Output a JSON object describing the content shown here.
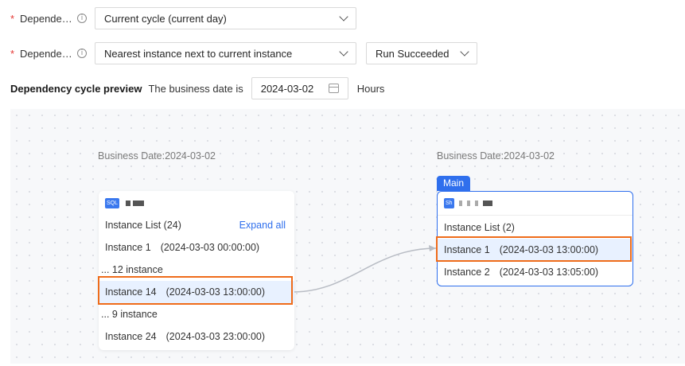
{
  "form": {
    "row1": {
      "label": "Depende…",
      "value": "Current cycle (current day)"
    },
    "row2": {
      "label": "Depende…",
      "value": "Nearest instance next to current instance",
      "status_value": "Run Succeeded"
    },
    "required_mark": "*",
    "info_icon": "info-circle-icon"
  },
  "preview": {
    "title": "Dependency cycle preview",
    "subtitle": "The business date is",
    "date": "2024-03-02",
    "unit": "Hours"
  },
  "upstream": {
    "business_date": "Business Date:2024-03-02",
    "tag": "SQL",
    "list_header": "Instance List (24)",
    "expand_label": "Expand all",
    "items": [
      {
        "name": "Instance 1",
        "time": "(2024-03-03 00:00:00)"
      },
      {
        "collapsed": "... 12 instance"
      },
      {
        "name": "Instance 14",
        "time": "(2024-03-03 13:00:00)"
      },
      {
        "collapsed": "... 9 instance"
      },
      {
        "name": "Instance 24",
        "time": "(2024-03-03 23:00:00)"
      }
    ]
  },
  "current": {
    "business_date": "Business Date:2024-03-02",
    "badge": "Main",
    "tag": "Sh",
    "list_header": "Instance List (2)",
    "items": [
      {
        "name": "Instance 1",
        "time": "(2024-03-03 13:00:00)"
      },
      {
        "name": "Instance 2",
        "time": "(2024-03-03 13:05:00)"
      }
    ]
  },
  "colors": {
    "accent": "#2f6fed",
    "highlight_box": "#ef6c1a",
    "required": "#e53935"
  }
}
